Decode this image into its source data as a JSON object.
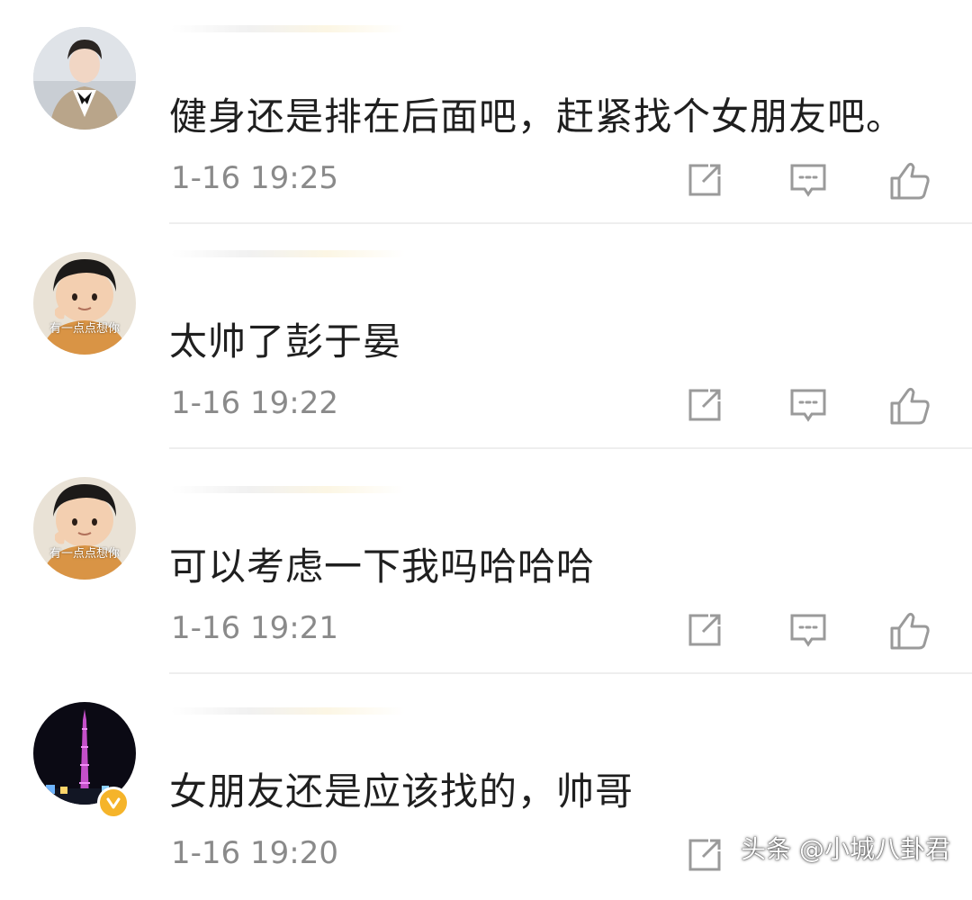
{
  "comments": [
    {
      "avatar": "man-in-suit-avatar",
      "avatar_caption": "",
      "text": "健身还是排在后面吧，赶紧找个女朋友吧。",
      "time": "1-16 19:25"
    },
    {
      "avatar": "child-avatar",
      "avatar_caption": "有一点点想你",
      "text": "太帅了彭于晏",
      "time": "1-16 19:22"
    },
    {
      "avatar": "child-avatar",
      "avatar_caption": "有一点点想你",
      "text": "可以考虑一下我吗哈哈哈",
      "time": "1-16 19:21"
    },
    {
      "avatar": "city-tower-night-avatar",
      "avatar_caption": "",
      "verified": true,
      "text": "女朋友还是应该找的，帅哥",
      "time": "1-16 19:20"
    }
  ],
  "icons": {
    "share": "share-icon",
    "reply": "comment-icon",
    "like": "thumbs-up-icon"
  },
  "colors": {
    "text": "#1f1f1f",
    "timestamp": "#8a8a8a",
    "icon": "#9a9a9a",
    "divider": "#eeeeee",
    "verified": "#f5b42a"
  },
  "watermark": "头条 @小城八卦君"
}
